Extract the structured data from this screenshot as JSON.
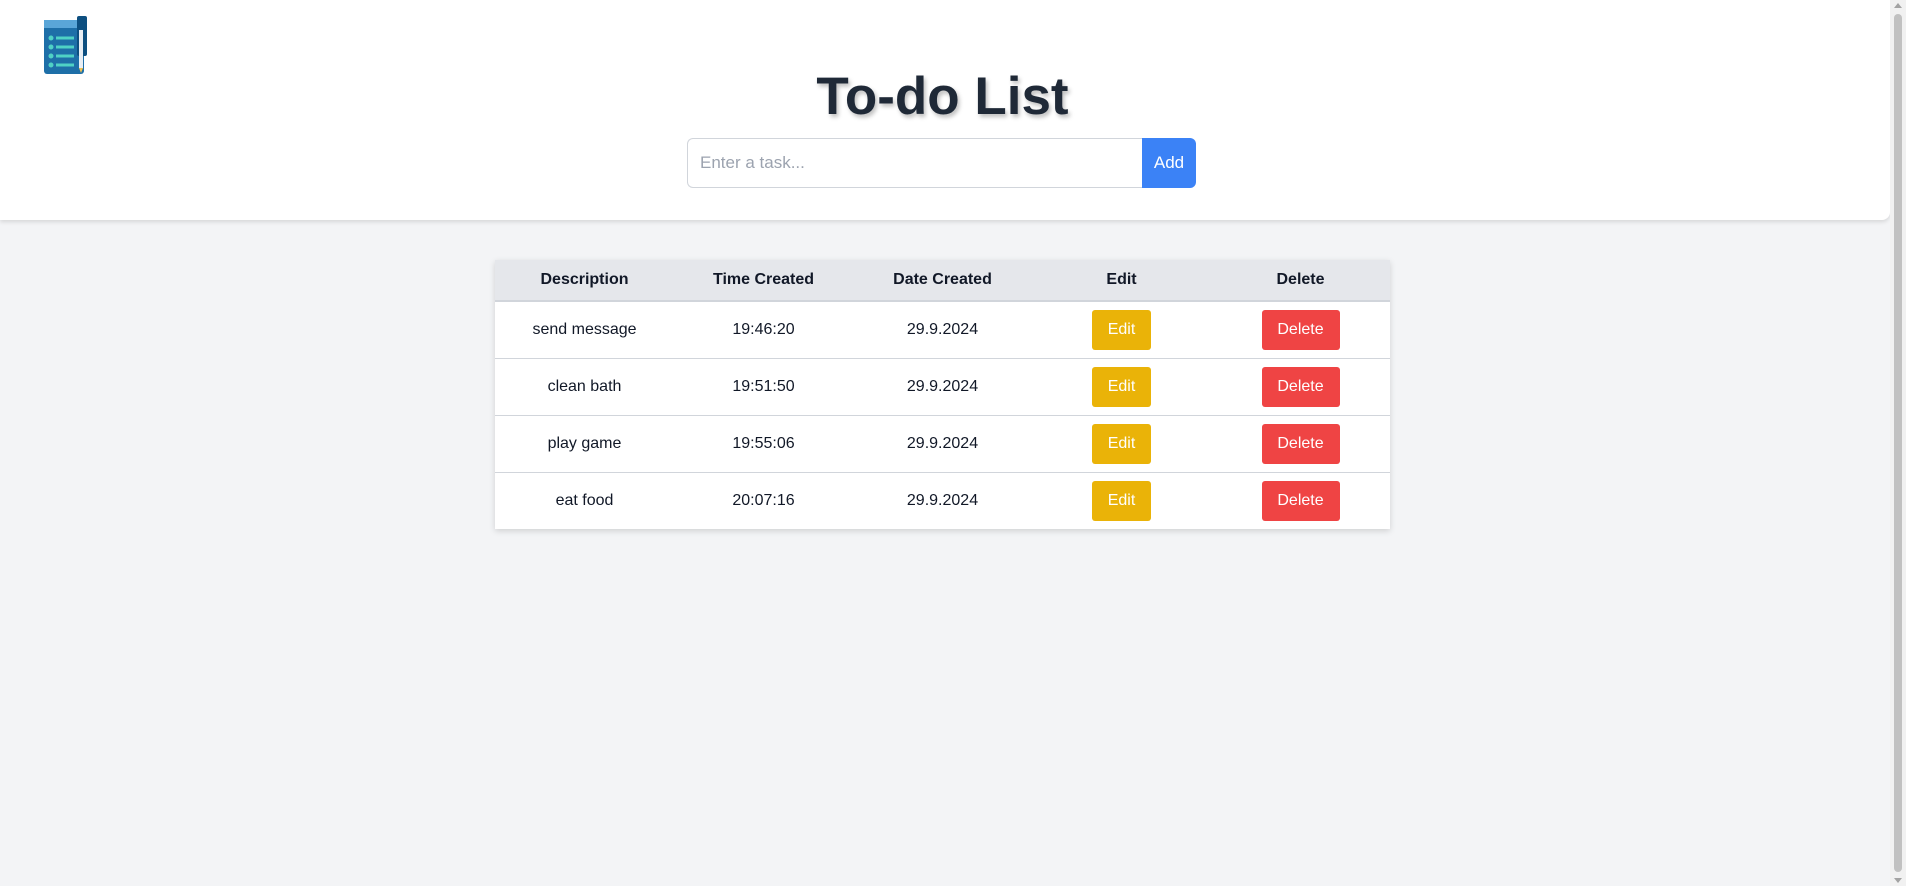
{
  "app": {
    "title": "To-do List",
    "logo_icon": "notepad-checklist-icon"
  },
  "form": {
    "placeholder": "Enter a task...",
    "value": "",
    "add_label": "Add"
  },
  "table": {
    "headers": [
      "Description",
      "Time Created",
      "Date Created",
      "Edit",
      "Delete"
    ],
    "rows": [
      {
        "description": "send message",
        "time": "19:46:20",
        "date": "29.9.2024",
        "edit": "Edit",
        "delete": "Delete"
      },
      {
        "description": "clean bath",
        "time": "19:51:50",
        "date": "29.9.2024",
        "edit": "Edit",
        "delete": "Delete"
      },
      {
        "description": "play game",
        "time": "19:55:06",
        "date": "29.9.2024",
        "edit": "Edit",
        "delete": "Delete"
      },
      {
        "description": "eat food",
        "time": "20:07:16",
        "date": "29.9.2024",
        "edit": "Edit",
        "delete": "Delete"
      }
    ]
  },
  "colors": {
    "add_button": "#3b82f6",
    "edit_button": "#eab308",
    "delete_button": "#ef4444",
    "page_background": "#f3f4f6"
  }
}
